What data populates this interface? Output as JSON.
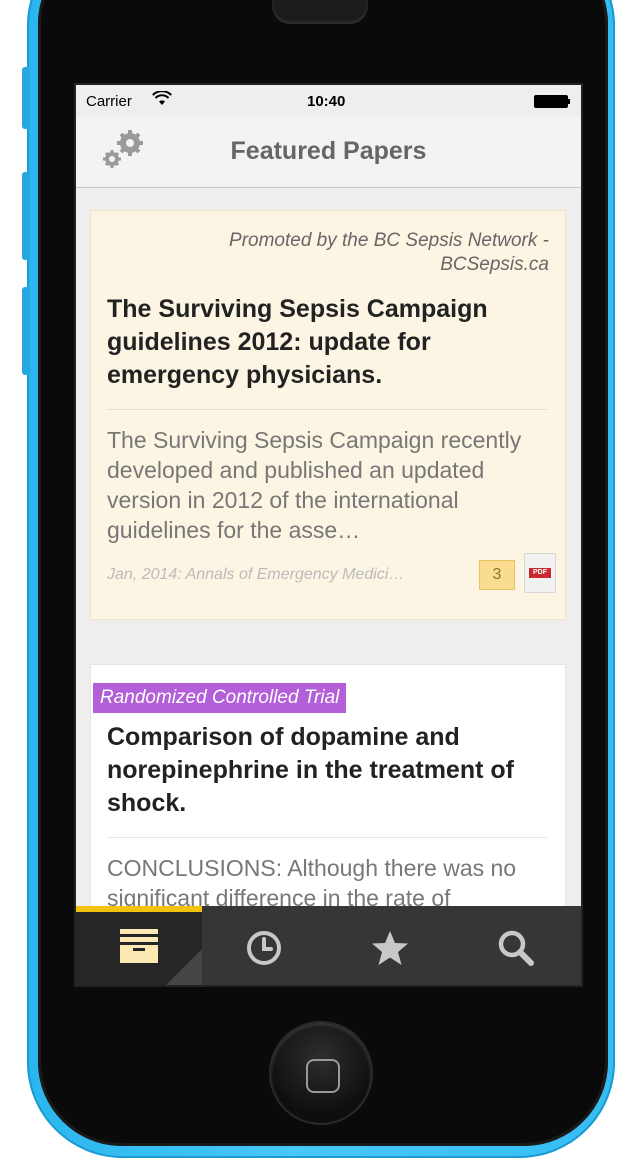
{
  "status_bar": {
    "carrier": "Carrier",
    "time": "10:40"
  },
  "nav": {
    "title": "Featured Papers",
    "settings_icon": "gear-icon"
  },
  "cards": [
    {
      "promoted_by": "Promoted by the BC Sepsis Network - BCSepsis.ca",
      "title": "The Surviving Sepsis Campaign guidelines 2012: update for emergency physicians.",
      "abstract": "The Surviving Sepsis Campaign recently developed and published an updated version in 2012 of the international guidelines for the asse…",
      "meta": "Jan, 2014: Annals of Emergency Medici…",
      "comment_count": "3",
      "pdf_label": "PDF",
      "background": "#fdf5e3"
    },
    {
      "study_type": "Randomized Controlled Trial",
      "title": "Comparison of dopamine and norepinephrine in the treatment of shock.",
      "abstract": "CONCLUSIONS: Although there was no significant difference in the rate of",
      "badge_color": "#b25fd9"
    }
  ],
  "tabs": [
    {
      "name": "featured",
      "icon": "inbox-icon",
      "active": true
    },
    {
      "name": "recent",
      "icon": "clock-icon",
      "active": false
    },
    {
      "name": "favorites",
      "icon": "star-icon",
      "active": false
    },
    {
      "name": "search",
      "icon": "search-icon",
      "active": false
    }
  ],
  "colors": {
    "phone_body": "#35bdf3",
    "tab_active_indicator": "#f4c20d",
    "tab_bar": "#363636"
  }
}
